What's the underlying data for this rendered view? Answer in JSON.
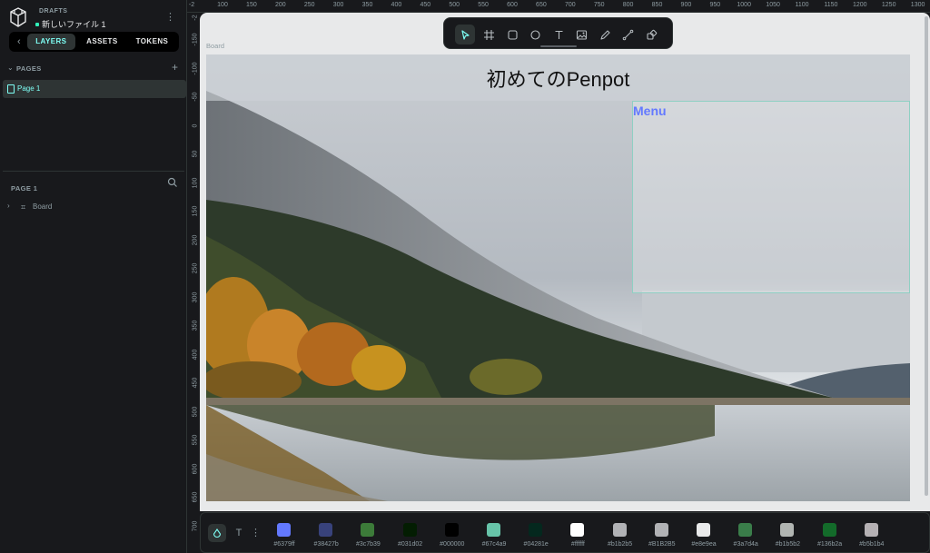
{
  "project": {
    "folder": "DRAFTS",
    "file_name": "新しいファイル 1"
  },
  "tabs": {
    "back": "‹",
    "layers": "LAYERS",
    "assets": "ASSETS",
    "tokens": "TOKENS"
  },
  "pages": {
    "title": "PAGES",
    "add": "+",
    "items": [
      {
        "label": "Page 1"
      }
    ]
  },
  "layers": {
    "title": "PAGE 1",
    "items": [
      {
        "label": "Board"
      }
    ]
  },
  "ruler": {
    "top": [
      "100",
      "150",
      "200",
      "250",
      "300",
      "350",
      "400",
      "450",
      "500",
      "550",
      "600",
      "650",
      "700",
      "750",
      "800",
      "850",
      "900",
      "950",
      "1000",
      "1050",
      "1100",
      "1150",
      "1200",
      "1250",
      "1300"
    ],
    "top_first": "-2",
    "left": [
      "-150",
      "-100",
      "-50",
      "0",
      "50",
      "100",
      "150",
      "200",
      "250",
      "300",
      "350",
      "400",
      "450",
      "500",
      "550",
      "600",
      "650",
      "700"
    ],
    "left_first": "-2"
  },
  "canvas": {
    "board_label": "Board",
    "header_text": "初めてのPenpot",
    "menu_label": "Menu"
  },
  "palette": {
    "colors": [
      {
        "hex": "#6379ff",
        "label": "#6379ff"
      },
      {
        "hex": "#38427b",
        "label": "#38427b"
      },
      {
        "hex": "#3c7b39",
        "label": "#3c7b39"
      },
      {
        "hex": "#031d02",
        "label": "#031d02"
      },
      {
        "hex": "#000000",
        "label": "#000000"
      },
      {
        "hex": "#67c4a9",
        "label": "#67c4a9"
      },
      {
        "hex": "#04281e",
        "label": "#04281e"
      },
      {
        "hex": "#ffffff",
        "label": "#ffffff"
      },
      {
        "hex": "#b1b2b5",
        "label": "#b1b2b5"
      },
      {
        "hex": "#b1b2b5",
        "label": "#B1B2B5"
      },
      {
        "hex": "#e8e9ea",
        "label": "#e8e9ea"
      },
      {
        "hex": "#3a7d4a",
        "label": "#3a7d4a"
      },
      {
        "hex": "#b1b5b2",
        "label": "#b1b5b2"
      },
      {
        "hex": "#136b2a",
        "label": "#136b2a"
      },
      {
        "hex": "#b5b1b4",
        "label": "#b5b1b4"
      }
    ]
  },
  "theme": {
    "accent": "#7efff5",
    "panel": "#18191c",
    "selected": "#2e3434",
    "canvas_bg": "#e8e9ea"
  }
}
